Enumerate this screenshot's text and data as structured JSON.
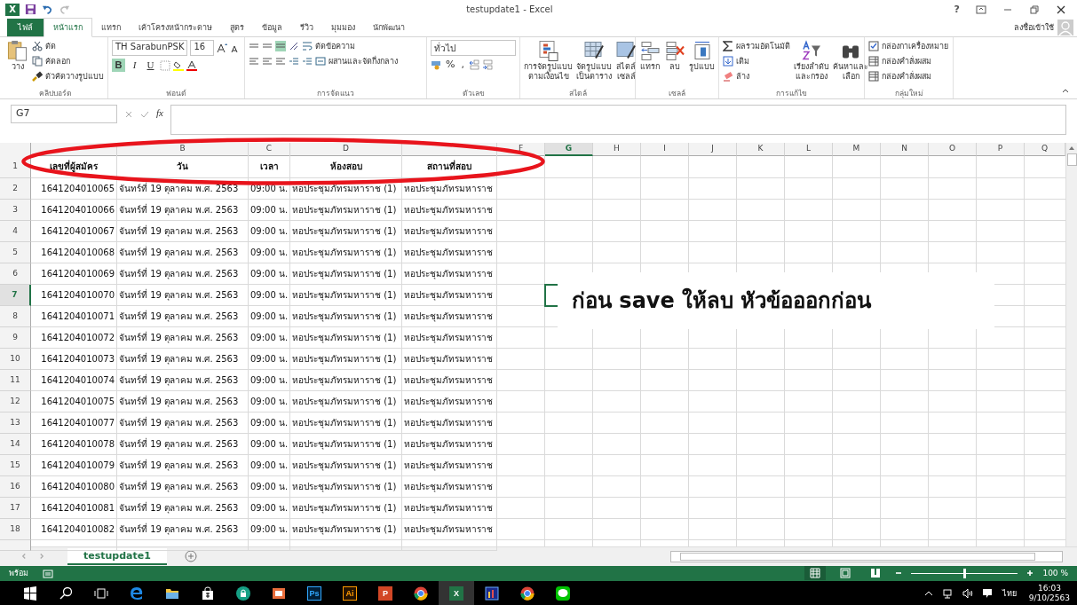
{
  "window": {
    "app_letter": "X",
    "title": "testupdate1 - Excel",
    "help": "?",
    "account": "ลงชื่อเข้าใช้"
  },
  "tabs": [
    {
      "label": "ไฟล์",
      "kind": "file",
      "selected": false
    },
    {
      "label": "หน้าแรก",
      "kind": "tab",
      "selected": true
    },
    {
      "label": "แทรก",
      "kind": "tab",
      "selected": false
    },
    {
      "label": "เค้าโครงหน้ากระดาษ",
      "kind": "tab",
      "selected": false
    },
    {
      "label": "สูตร",
      "kind": "tab",
      "selected": false
    },
    {
      "label": "ข้อมูล",
      "kind": "tab",
      "selected": false
    },
    {
      "label": "รีวิว",
      "kind": "tab",
      "selected": false
    },
    {
      "label": "มุมมอง",
      "kind": "tab",
      "selected": false
    },
    {
      "label": "นักพัฒนา",
      "kind": "tab",
      "selected": false
    }
  ],
  "ribbon": {
    "clipboard": {
      "label": "คลิปบอร์ด",
      "paste": "วาง",
      "cut": "ตัด",
      "copy": "คัดลอก",
      "format_painter": "ตัวคัดวางรูปแบบ"
    },
    "font": {
      "label": "ฟอนต์",
      "name": "TH SarabunPSK",
      "size": "16",
      "bold": {
        "label": "B",
        "on": true
      },
      "italic": {
        "label": "I",
        "on": false
      },
      "underline": {
        "label": "U",
        "on": false
      }
    },
    "alignment": {
      "label": "การจัดแนว",
      "wrap_text": "ตัดข้อความ",
      "merge_center": "ผสานและจัดกึ่งกลาง",
      "vertical": [
        {
          "selected": false
        },
        {
          "selected": false
        },
        {
          "selected": true
        }
      ]
    },
    "number": {
      "label": "ตัวเลข",
      "format": "ทั่วไป",
      "percent": "%",
      "comma": ","
    },
    "styles": {
      "label": "สไตล์",
      "conditional": [
        "การจัดรูปแบบ",
        "ตามเงื่อนไข"
      ],
      "as_table": [
        "จัดรูปแบบ",
        "เป็นตาราง"
      ],
      "cell_styles": [
        "สไตล์",
        "เซลล์"
      ]
    },
    "cells": {
      "label": "เซลล์",
      "insert": "แทรก",
      "delete": "ลบ",
      "format": "รูปแบบ"
    },
    "editing": {
      "label": "การแก้ไข",
      "autosum": "ผลรวมอัตโนมัติ",
      "fill": "เติม",
      "clear": "ล้าง",
      "sort_filter": [
        "เรียงลำดับ",
        "และกรอง"
      ],
      "find_select": [
        "ค้นหาและ",
        "เลือก"
      ]
    },
    "new_group": {
      "label": "กลุ่มใหม่",
      "items": [
        {
          "label": "กล่องกาเครื่องหมาย",
          "kind": "checkbox"
        },
        {
          "label": "กล่องคำสั่งผสม",
          "kind": "combo"
        },
        {
          "label": "กล่องคำสั่งผสม",
          "kind": "combo"
        }
      ]
    }
  },
  "formula_bar": {
    "name_box": "G7",
    "fx": "fx"
  },
  "sheet": {
    "columns": [
      {
        "selected": false
      },
      {
        "label": "B",
        "selected": false
      },
      {
        "label": "C",
        "selected": false
      },
      {
        "label": "D",
        "selected": false
      },
      {
        "selected": false
      },
      {
        "label": "F",
        "selected": false
      },
      {
        "label": "G",
        "selected": true
      },
      {
        "label": "H",
        "selected": false
      },
      {
        "label": "I",
        "selected": false
      },
      {
        "label": "J",
        "selected": false
      },
      {
        "label": "K",
        "selected": false
      },
      {
        "label": "L",
        "selected": false
      },
      {
        "label": "M",
        "selected": false
      },
      {
        "label": "N",
        "selected": false
      },
      {
        "label": "O",
        "selected": false
      },
      {
        "label": "P",
        "selected": false
      },
      {
        "label": "Q",
        "selected": false
      }
    ],
    "rows": [
      {
        "number": "1",
        "kind": "header",
        "selected": false,
        "cells": [
          "เลขที่ผู้สมัคร",
          "วัน",
          "เวลา",
          "ห้องสอบ",
          "สถานที่สอบ"
        ]
      },
      {
        "number": "2",
        "kind": "data",
        "selected": false,
        "cells": [
          "1641204010065",
          "จันทร์ที่ 19 ตุลาคม พ.ศ. 2563",
          "09:00 น.",
          "หอประชุมภัทรมหาราช (1)",
          "หอประชุมภัทรมหาราช"
        ]
      },
      {
        "number": "3",
        "kind": "data",
        "selected": false,
        "cells": [
          "1641204010066",
          "จันทร์ที่ 19 ตุลาคม พ.ศ. 2563",
          "09:00 น.",
          "หอประชุมภัทรมหาราช (1)",
          "หอประชุมภัทรมหาราช"
        ]
      },
      {
        "number": "4",
        "kind": "data",
        "selected": false,
        "cells": [
          "1641204010067",
          "จันทร์ที่ 19 ตุลาคม พ.ศ. 2563",
          "09:00 น.",
          "หอประชุมภัทรมหาราช (1)",
          "หอประชุมภัทรมหาราช"
        ]
      },
      {
        "number": "5",
        "kind": "data",
        "selected": false,
        "cells": [
          "1641204010068",
          "จันทร์ที่ 19 ตุลาคม พ.ศ. 2563",
          "09:00 น.",
          "หอประชุมภัทรมหาราช (1)",
          "หอประชุมภัทรมหาราช"
        ]
      },
      {
        "number": "6",
        "kind": "data",
        "selected": false,
        "cells": [
          "1641204010069",
          "จันทร์ที่ 19 ตุลาคม พ.ศ. 2563",
          "09:00 น.",
          "หอประชุมภัทรมหาราช (1)",
          "หอประชุมภัทรมหาราช"
        ]
      },
      {
        "number": "7",
        "kind": "data",
        "selected": true,
        "cells": [
          "1641204010070",
          "จันทร์ที่ 19 ตุลาคม พ.ศ. 2563",
          "09:00 น.",
          "หอประชุมภัทรมหาราช (1)",
          "หอประชุมภัทรมหาราช"
        ]
      },
      {
        "number": "8",
        "kind": "data",
        "selected": false,
        "cells": [
          "1641204010071",
          "จันทร์ที่ 19 ตุลาคม พ.ศ. 2563",
          "09:00 น.",
          "หอประชุมภัทรมหาราช (1)",
          "หอประชุมภัทรมหาราช"
        ]
      },
      {
        "number": "9",
        "kind": "data",
        "selected": false,
        "cells": [
          "1641204010072",
          "จันทร์ที่ 19 ตุลาคม พ.ศ. 2563",
          "09:00 น.",
          "หอประชุมภัทรมหาราช (1)",
          "หอประชุมภัทรมหาราช"
        ]
      },
      {
        "number": "10",
        "kind": "data",
        "selected": false,
        "cells": [
          "1641204010073",
          "จันทร์ที่ 19 ตุลาคม พ.ศ. 2563",
          "09:00 น.",
          "หอประชุมภัทรมหาราช (1)",
          "หอประชุมภัทรมหาราช"
        ]
      },
      {
        "number": "11",
        "kind": "data",
        "selected": false,
        "cells": [
          "1641204010074",
          "จันทร์ที่ 19 ตุลาคม พ.ศ. 2563",
          "09:00 น.",
          "หอประชุมภัทรมหาราช (1)",
          "หอประชุมภัทรมหาราช"
        ]
      },
      {
        "number": "12",
        "kind": "data",
        "selected": false,
        "cells": [
          "1641204010075",
          "จันทร์ที่ 19 ตุลาคม พ.ศ. 2563",
          "09:00 น.",
          "หอประชุมภัทรมหาราช (1)",
          "หอประชุมภัทรมหาราช"
        ]
      },
      {
        "number": "13",
        "kind": "data",
        "selected": false,
        "cells": [
          "1641204010077",
          "จันทร์ที่ 19 ตุลาคม พ.ศ. 2563",
          "09:00 น.",
          "หอประชุมภัทรมหาราช (1)",
          "หอประชุมภัทรมหาราช"
        ]
      },
      {
        "number": "14",
        "kind": "data",
        "selected": false,
        "cells": [
          "1641204010078",
          "จันทร์ที่ 19 ตุลาคม พ.ศ. 2563",
          "09:00 น.",
          "หอประชุมภัทรมหาราช (1)",
          "หอประชุมภัทรมหาราช"
        ]
      },
      {
        "number": "15",
        "kind": "data",
        "selected": false,
        "cells": [
          "1641204010079",
          "จันทร์ที่ 19 ตุลาคม พ.ศ. 2563",
          "09:00 น.",
          "หอประชุมภัทรมหาราช (1)",
          "หอประชุมภัทรมหาราช"
        ]
      },
      {
        "number": "16",
        "kind": "data",
        "selected": false,
        "cells": [
          "1641204010080",
          "จันทร์ที่ 19 ตุลาคม พ.ศ. 2563",
          "09:00 น.",
          "หอประชุมภัทรมหาราช (1)",
          "หอประชุมภัทรมหาราช"
        ]
      },
      {
        "number": "17",
        "kind": "data",
        "selected": false,
        "cells": [
          "1641204010081",
          "จันทร์ที่ 19 ตุลาคม พ.ศ. 2563",
          "09:00 น.",
          "หอประชุมภัทรมหาราช (1)",
          "หอประชุมภัทรมหาราช"
        ]
      },
      {
        "number": "18",
        "kind": "data",
        "selected": false,
        "cells": [
          "1641204010082",
          "จันทร์ที่ 19 ตุลาคม พ.ศ. 2563",
          "09:00 น.",
          "หอประชุมภัทรมหาราช (1)",
          "หอประชุมภัทรมหาราช"
        ]
      }
    ]
  },
  "note": {
    "text": "ก่อน save ให้ลบ หัวข้อออกก่อน"
  },
  "sheet_tabs": [
    {
      "label": "testupdate1",
      "selected": true
    }
  ],
  "status_bar": {
    "status": "พร้อม",
    "zoom": "100 %",
    "level": 0.5
  },
  "taskbar": {
    "apps": [
      {
        "kind": "start",
        "selected": false
      },
      {
        "kind": "search",
        "selected": false
      },
      {
        "kind": "task-view",
        "selected": false
      },
      {
        "kind": "edge",
        "selected": false
      },
      {
        "kind": "folder",
        "selected": false
      },
      {
        "kind": "store",
        "selected": false
      },
      {
        "kind": "lock",
        "selected": false
      },
      {
        "kind": "slides",
        "selected": false
      },
      {
        "kind": "ps",
        "label": "Ps",
        "selected": false
      },
      {
        "kind": "ai",
        "label": "Ai",
        "selected": false
      },
      {
        "kind": "ppt",
        "label": "P",
        "selected": false
      },
      {
        "kind": "chrome",
        "selected": false
      },
      {
        "kind": "excel",
        "label": "X",
        "selected": true
      },
      {
        "kind": "chart",
        "selected": false
      },
      {
        "kind": "chrome",
        "selected": false
      },
      {
        "kind": "line",
        "selected": false
      }
    ],
    "language": "ไทย",
    "time": "16:03",
    "date": "9/10/2563"
  }
}
